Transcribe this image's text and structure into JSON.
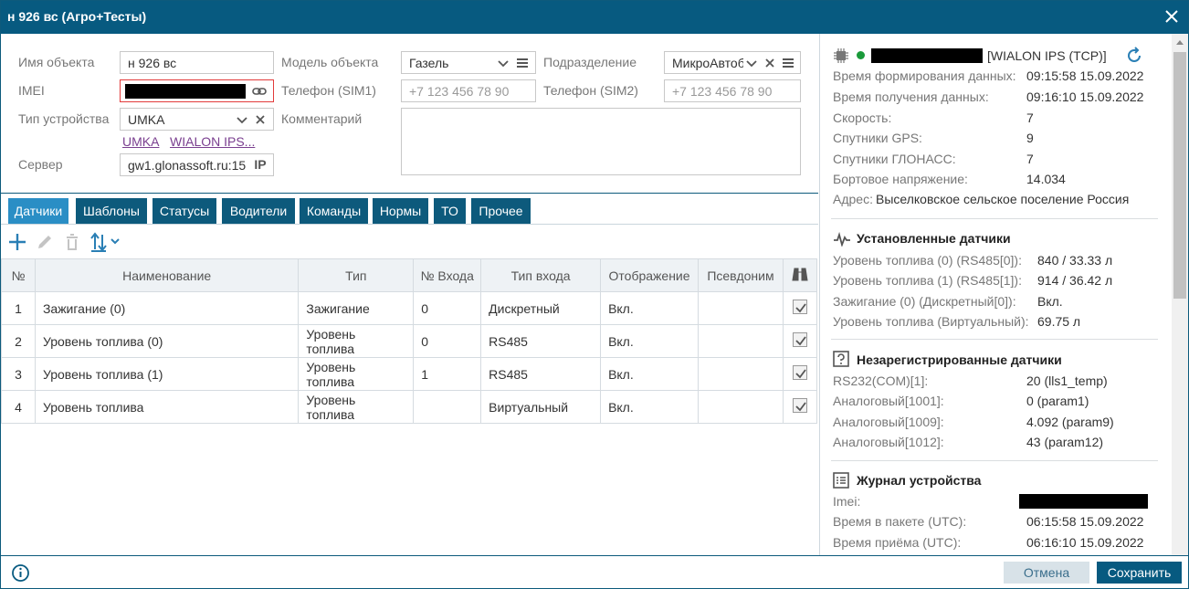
{
  "window": {
    "title": "н 926 вс (Агро+Тесты)"
  },
  "form": {
    "name_label": "Имя объекта",
    "name_value": "н 926 вс",
    "model_label": "Модель объекта",
    "model_value": "Газель",
    "division_label": "Подразделение",
    "division_value": "МикроАвтоб",
    "imei_label": "IMEI",
    "sim1_label": "Телефон (SIM1)",
    "sim1_placeholder": "+7 123 456 78 90",
    "sim2_label": "Телефон (SIM2)",
    "sim2_placeholder": "+7 123 456 78 90",
    "device_label": "Тип устройства",
    "device_value": "UMKA",
    "comment_label": "Комментарий",
    "link1": "UMKA",
    "link2": "WIALON IPS...",
    "server_label": "Сервер",
    "server_value": "gw1.glonassoft.ru:15",
    "server_badge": "IP"
  },
  "tabs": [
    "Датчики",
    "Шаблоны",
    "Статусы",
    "Водители",
    "Команды",
    "Нормы",
    "ТО",
    "Прочее"
  ],
  "table": {
    "headers": [
      "№",
      "Наименование",
      "Тип",
      "№ Входа",
      "Тип входа",
      "Отображение",
      "Псевдоним"
    ],
    "rows": [
      {
        "n": "1",
        "name": "Зажигание (0)",
        "type": "Зажигание",
        "input": "0",
        "input_type": "Дискретный",
        "display": "Вкл.",
        "alias": ""
      },
      {
        "n": "2",
        "name": "Уровень топлива (0)",
        "type": "Уровень топлива",
        "input": "0",
        "input_type": "RS485",
        "display": "Вкл.",
        "alias": ""
      },
      {
        "n": "3",
        "name": "Уровень топлива (1)",
        "type": "Уровень топлива",
        "input": "1",
        "input_type": "RS485",
        "display": "Вкл.",
        "alias": ""
      },
      {
        "n": "4",
        "name": "Уровень топлива",
        "type": "Уровень топлива",
        "input": "",
        "input_type": "Виртуальный",
        "display": "Вкл.",
        "alias": ""
      }
    ]
  },
  "info": {
    "protocol": "[WIALON IPS (TCP)]",
    "status_color": "#1a9a3a",
    "rows": [
      {
        "label": "Время формирования данных:",
        "value": "09:15:58 15.09.2022"
      },
      {
        "label": "Время получения данных:",
        "value": "09:16:10 15.09.2022"
      },
      {
        "label": "Скорость:",
        "value": "7"
      },
      {
        "label": "Спутники GPS:",
        "value": "9"
      },
      {
        "label": "Спутники ГЛОНАСС:",
        "value": "7"
      },
      {
        "label": "Бортовое напряжение:",
        "value": "14.034"
      }
    ],
    "address_label": "Адрес:",
    "address_value": "Выселковское сельское поселение Россия",
    "installed_title": "Установленные датчики",
    "installed": [
      {
        "label": "Уровень топлива (0) (RS485[0]):",
        "value": "840 / 33.33 л"
      },
      {
        "label": "Уровень топлива (1) (RS485[1]):",
        "value": "914 / 36.42 л"
      },
      {
        "label": "Зажигание (0) (Дискретный[0]):",
        "value": "Вкл."
      },
      {
        "label": "Уровень топлива (Виртуальный):",
        "value": "69.75 л"
      }
    ],
    "unreg_title": "Незарегистрированные датчики",
    "unreg": [
      {
        "label": "RS232(COM)[1]:",
        "value": "20 (lls1_temp)"
      },
      {
        "label": "Аналоговый[1001]:",
        "value": "0 (param1)"
      },
      {
        "label": "Аналоговый[1009]:",
        "value": "4.092 (param9)"
      },
      {
        "label": "Аналоговый[1012]:",
        "value": "43 (param12)"
      }
    ],
    "log_title": "Журнал устройства",
    "log": [
      {
        "label": "Imei:",
        "value": ""
      },
      {
        "label": "Время в пакете (UTC):",
        "value": "06:15:58 15.09.2022"
      },
      {
        "label": "Время приёма (UTC):",
        "value": "06:16:10 15.09.2022"
      }
    ]
  },
  "footer": {
    "cancel": "Отмена",
    "save": "Сохранить"
  }
}
